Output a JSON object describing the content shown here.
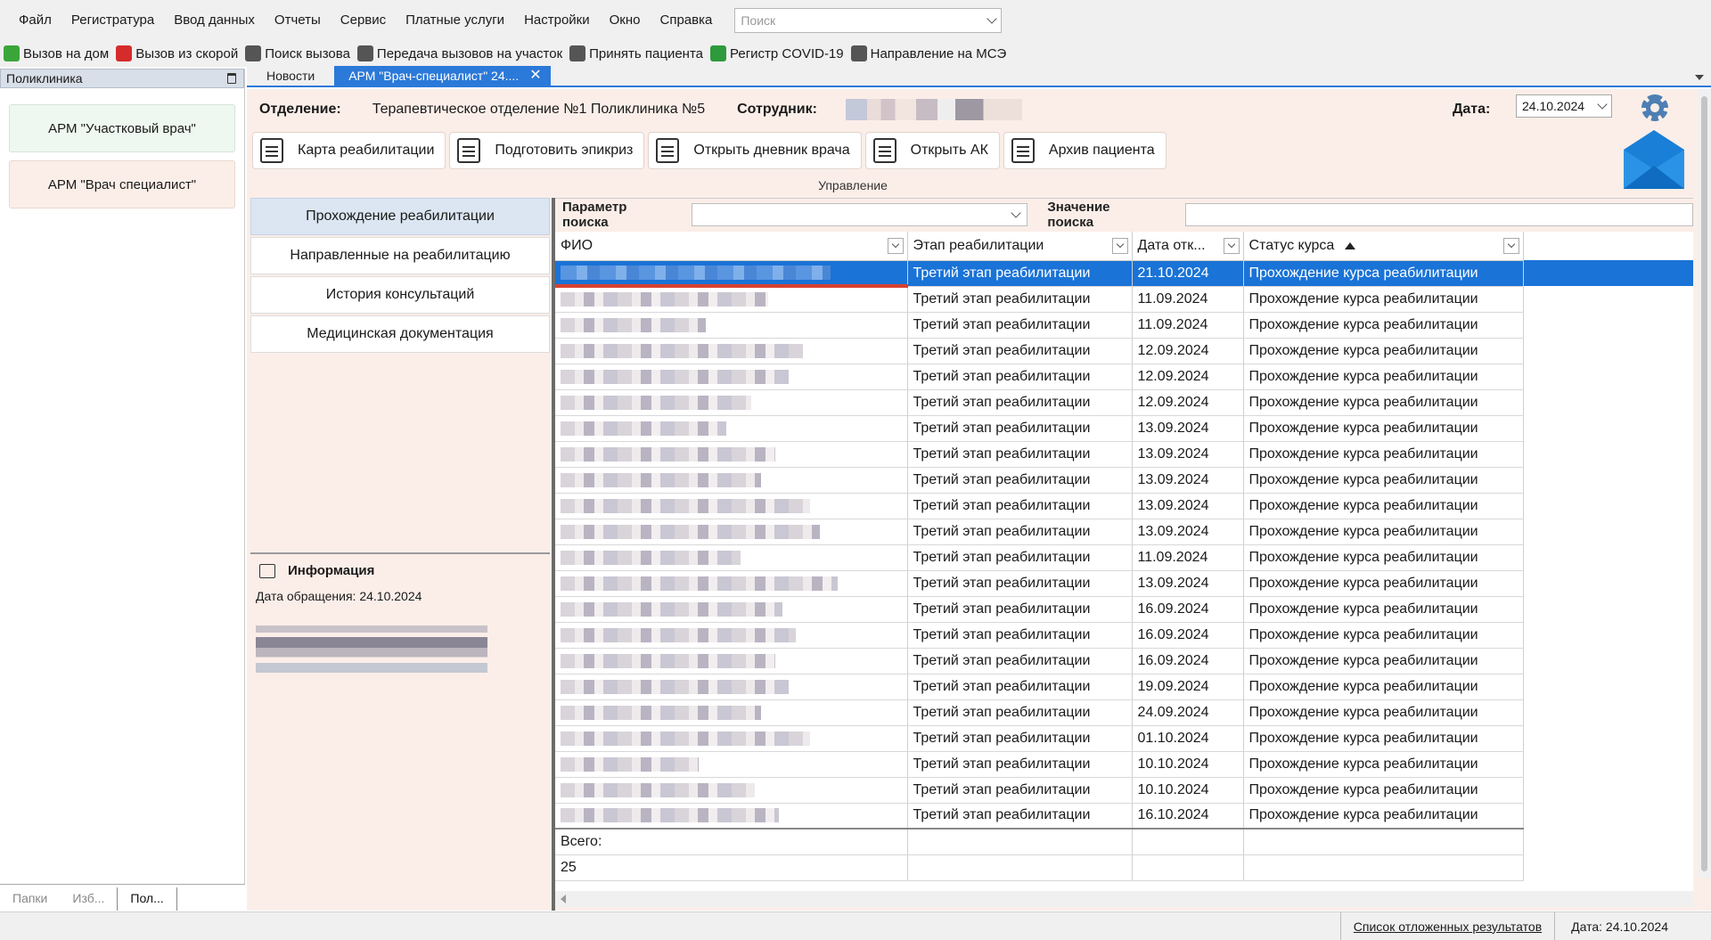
{
  "menu": [
    "Файл",
    "Регистратура",
    "Ввод данных",
    "Отчеты",
    "Сервис",
    "Платные услуги",
    "Настройки",
    "Окно",
    "Справка"
  ],
  "search_placeholder": "Поиск",
  "toolbar": [
    {
      "label": "Вызов на дом",
      "icon": "house-call-icon",
      "color": "#3aa63a"
    },
    {
      "label": "Вызов из скорой",
      "icon": "ambulance-call-icon",
      "color": "#d62b2b"
    },
    {
      "label": "Поиск вызова",
      "icon": "search-call-icon",
      "color": "#555555"
    },
    {
      "label": "Передача вызовов на участок",
      "icon": "transfer-calls-icon",
      "color": "#555555"
    },
    {
      "label": "Принять пациента",
      "icon": "accept-patient-icon",
      "color": "#555555"
    },
    {
      "label": "Регистр COVID-19",
      "icon": "covid-virus-icon",
      "color": "#2e9a3c"
    },
    {
      "label": "Направление на МСЭ",
      "icon": "mse-referral-icon",
      "color": "#555555"
    }
  ],
  "left_panel": {
    "title": "Поликлиника",
    "buttons": [
      "АРМ \"Участковый врач\"",
      "АРМ \"Врач специалист\""
    ],
    "tabs": [
      "Папки",
      "Изб...",
      "Пол..."
    ]
  },
  "doc_tabs": [
    "Новости",
    "АРМ \"Врач-специалист\" 24...."
  ],
  "header": {
    "dept_label": "Отделение:",
    "dept_value": "Терапевтическое отделение №1 Поликлиника №5",
    "employee_label": "Сотрудник:",
    "date_label": "Дата:",
    "date_value": "24.10.2024"
  },
  "actions": [
    "Карта реабилитации",
    "Подготовить эпикриз",
    "Открыть дневник врача",
    "Открыть АК",
    "Архив пациента"
  ],
  "actions_group_label": "Управление",
  "nav": [
    "Прохождение реабилитации",
    "Направленные на реабилитацию",
    "История консультаций",
    "Медицинская документация"
  ],
  "info": {
    "title": "Информация",
    "date_line": "Дата обращения: 24.10.2024"
  },
  "search": {
    "param_label": "Параметр поиска",
    "value_label": "Значение поиска"
  },
  "grid": {
    "columns": [
      "ФИО",
      "Этап реабилитации",
      "Дата отк...",
      "Статус курса"
    ],
    "stage": "Третий этап реабилитации",
    "status": "Прохождение курса реабилитации",
    "dates": [
      "21.10.2024",
      "11.09.2024",
      "11.09.2024",
      "12.09.2024",
      "12.09.2024",
      "12.09.2024",
      "13.09.2024",
      "13.09.2024",
      "13.09.2024",
      "13.09.2024",
      "13.09.2024",
      "11.09.2024",
      "13.09.2024",
      "16.09.2024",
      "16.09.2024",
      "16.09.2024",
      "19.09.2024",
      "24.09.2024",
      "01.10.2024",
      "10.10.2024",
      "10.10.2024",
      "16.10.2024"
    ],
    "total_label": "Всего:",
    "total_value": "25"
  },
  "status_bar": {
    "link": "Список отложенных результатов",
    "date": "Дата: 24.10.2024"
  }
}
